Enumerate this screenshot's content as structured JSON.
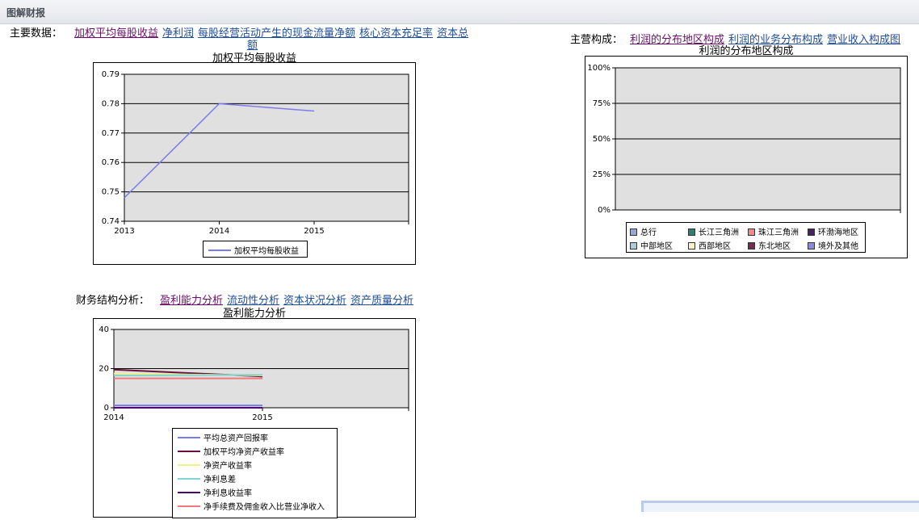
{
  "window": {
    "title": "图解财报"
  },
  "main_data": {
    "label": "主要数据：",
    "links": [
      "加权平均每股收益",
      "净利润",
      "每股经营活动产生的现金流量净额",
      "核心资本充足率",
      "资本总",
      "额"
    ],
    "active": 0
  },
  "composition": {
    "label": "主营构成：",
    "links": [
      "利润的分布地区构成",
      "利润的业务分布构成",
      "营业收入构成图"
    ],
    "active": 0
  },
  "financial": {
    "label": "财务结构分析：",
    "links": [
      "盈利能力分析",
      "流动性分析",
      "资本状况分析",
      "资产质量分析"
    ],
    "active": 0
  },
  "colors": {
    "link": "#1f4e9c",
    "visited": "#6b0f6b",
    "plot_bg": "#e0e0e0"
  },
  "chart_data": [
    {
      "type": "line",
      "title": "加权平均每股收益",
      "x_ticks": [
        "2013",
        "2014",
        "2015"
      ],
      "y_ticks": [
        "0.79",
        "0.78",
        "0.77",
        "0.76",
        "0.75",
        "0.74"
      ],
      "ylim": [
        0.74,
        0.79
      ],
      "series": [
        {
          "name": "加权平均每股收益",
          "color": "#7b7bf0",
          "x": [
            2013,
            2014,
            2015
          ],
          "values": [
            0.748,
            0.78,
            0.7775
          ]
        }
      ],
      "grid": true,
      "legend": "bottom"
    },
    {
      "type": "bar",
      "title": "利润的分布地区构成",
      "y_ticks": [
        "100%",
        "75%",
        "50%",
        "25%",
        "0%"
      ],
      "ylim": [
        0,
        100
      ],
      "series": [
        {
          "name": "总行",
          "color": "#9aa6d6"
        },
        {
          "name": "长江三角洲",
          "color": "#2e7f6e"
        },
        {
          "name": "珠江三角洲",
          "color": "#f08a8a"
        },
        {
          "name": "环渤海地区",
          "color": "#4b1f66"
        },
        {
          "name": "中部地区",
          "color": "#a8cfd8"
        },
        {
          "name": "西部地区",
          "color": "#fff4c8"
        },
        {
          "name": "东北地区",
          "color": "#7a2a4a"
        },
        {
          "name": "境外及其他",
          "color": "#8a8ae0"
        }
      ],
      "grid": true,
      "legend": "bottom"
    },
    {
      "type": "line",
      "title": "盈利能力分析",
      "x_ticks": [
        "2014",
        "2015"
      ],
      "y_ticks": [
        "40",
        "20",
        "0"
      ],
      "ylim": [
        0,
        40
      ],
      "series": [
        {
          "name": "平均总资产回报率",
          "color": "#7b7bf0",
          "x": [
            2014,
            2015
          ],
          "values": [
            1.2,
            1.2
          ]
        },
        {
          "name": "加权平均净资产收益率",
          "color": "#6b0f3a",
          "x": [
            2014,
            2015
          ],
          "values": [
            19.5,
            16.0
          ]
        },
        {
          "name": "净资产收益率",
          "color": "#f2f28a",
          "x": [
            2014,
            2015
          ],
          "values": [
            17.5,
            16.5
          ]
        },
        {
          "name": "净利息差",
          "color": "#7fd6cf",
          "x": [
            2014,
            2015
          ],
          "values": [
            16.5,
            16.8
          ]
        },
        {
          "name": "净利息收益率",
          "color": "#4b0a6b",
          "x": [
            2014,
            2015
          ],
          "values": [
            0,
            0
          ]
        },
        {
          "name": "净手续费及佣金收入比营业净收入",
          "color": "#f07a7a",
          "x": [
            2014,
            2015
          ],
          "values": [
            15.0,
            15.0
          ]
        }
      ],
      "grid": true,
      "legend": "bottom"
    }
  ]
}
